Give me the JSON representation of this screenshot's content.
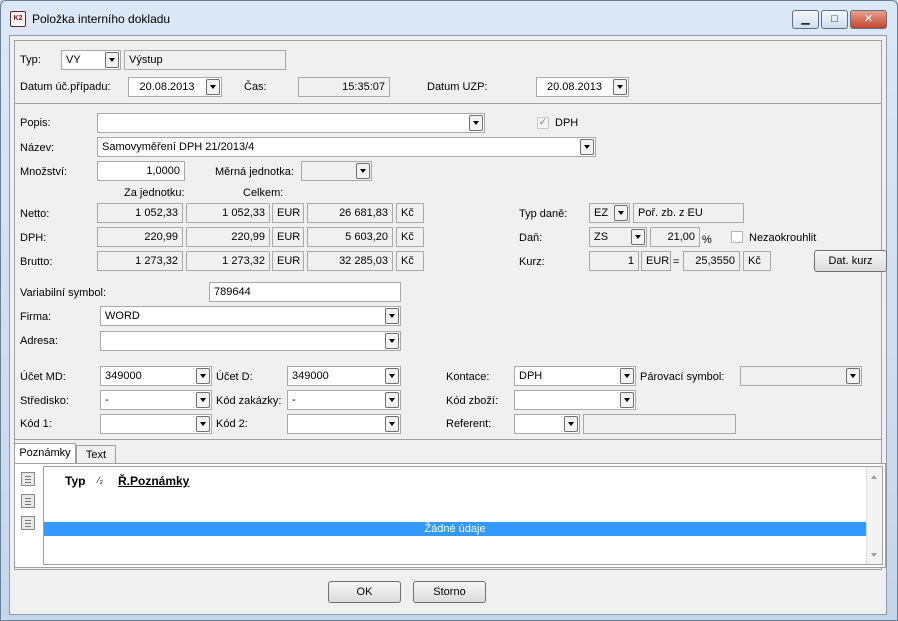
{
  "window": {
    "title": "Položka interního dokladu",
    "app_icon": "K2",
    "minimize_icon": "minimize-icon",
    "maximize_icon": "maximize-icon",
    "close_icon": "close-icon",
    "minimize_glyph": "▁",
    "maximize_glyph": "□",
    "close_glyph": "✕"
  },
  "header": {
    "typ_label": "Typ:",
    "typ_value": "VY",
    "typ_desc": "Výstup",
    "datum_label": "Datum úč.případu:",
    "datum_value": "20.08.2013",
    "cas_label": "Čas:",
    "cas_value": "15:35:07",
    "uzp_label": "Datum UZP:",
    "uzp_value": "20.08.2013"
  },
  "item": {
    "popis_label": "Popis:",
    "popis_value": "",
    "dph_check_label": "DPH",
    "dph_checked": true,
    "check_glyph": "✓",
    "nazev_label": "Název:",
    "nazev_value": "Samovyměření DPH 21/2013/4",
    "mnozstvi_label": "Množství:",
    "mnozstvi_value": "1,0000",
    "merna_label": "Měrná jednotka:",
    "merna_value": "",
    "za_jednotku_label": "Za jednotku:",
    "celkem_label": "Celkem:"
  },
  "amounts": [
    {
      "label": "Netto:",
      "unit": "1 052,33",
      "total": "1 052,33",
      "cur": "EUR",
      "czk": "26 681,83",
      "czk_cur": "Kč"
    },
    {
      "label": "DPH:",
      "unit": "220,99",
      "total": "220,99",
      "cur": "EUR",
      "czk": "5 603,20",
      "czk_cur": "Kč"
    },
    {
      "label": "Brutto:",
      "unit": "1 273,32",
      "total": "1 273,32",
      "cur": "EUR",
      "czk": "32 285,03",
      "czk_cur": "Kč"
    }
  ],
  "tax": {
    "typ_dane_label": "Typ daně:",
    "typ_dane_value": "EZ",
    "typ_dane_desc": "Poř. zb. z EU",
    "dan_label": "Daň:",
    "dan_value": "ZS",
    "dan_rate": "21,00",
    "percent": "%",
    "nezaokrouhlit_label": "Nezaokrouhlit",
    "kurz_label": "Kurz:",
    "kurz_amount": "1",
    "kurz_cur": "EUR",
    "equals": "=",
    "kurz_value": "25,3550",
    "kurz_czk": "Kč",
    "dat_kurz_button": "Dat. kurz"
  },
  "partner": {
    "vs_label": "Variabilní symbol:",
    "vs_value": "789644",
    "firma_label": "Firma:",
    "firma_value": "WORD",
    "adresa_label": "Adresa:",
    "adresa_value": ""
  },
  "accounting": {
    "ucet_md_label": "Účet MD:",
    "ucet_md_value": "349000",
    "ucet_d_label": "Účet D:",
    "ucet_d_value": "349000",
    "kontace_label": "Kontace:",
    "kontace_value": "DPH",
    "parovaci_label": "Párovací symbol:",
    "parovaci_value": "",
    "stredisko_label": "Středisko:",
    "stredisko_value": "-",
    "kod_zakazky_label": "Kód zakázky:",
    "kod_zakazky_value": "-",
    "kod_zbozi_label": "Kód zboží:",
    "kod_zbozi_value": "",
    "kod1_label": "Kód 1:",
    "kod1_value": "",
    "kod2_label": "Kód 2:",
    "kod2_value": "",
    "referent_label": "Referent:",
    "referent_value": "",
    "referent_name": ""
  },
  "tabs": [
    {
      "label": "Poznámky",
      "active": true
    },
    {
      "label": "Text",
      "active": false
    }
  ],
  "notes_grid": {
    "col_typ": "Typ",
    "col_sort": "⁄₂",
    "col_poznamky": "Ř.Poznámky",
    "no_data": "Žádné údaje"
  },
  "footer": {
    "ok_label": "OK",
    "storno_label": "Storno"
  }
}
